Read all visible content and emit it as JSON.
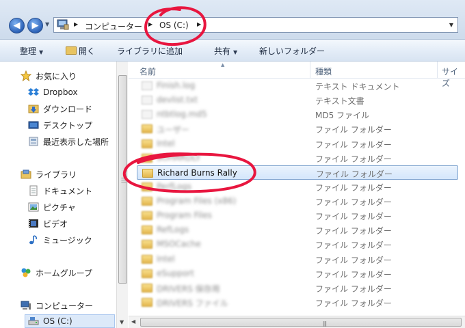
{
  "address": {
    "crumbs": [
      "コンピューター",
      "OS (C:)"
    ],
    "nav_back_glyph": "◀",
    "nav_forward_glyph": "▶"
  },
  "toolbar": {
    "organize": "整理",
    "open": "開く",
    "library": "ライブラリに追加",
    "share": "共有",
    "new_folder": "新しいフォルダー"
  },
  "sidebar": {
    "favorites": "お気に入り",
    "favorites_items": [
      "Dropbox",
      "ダウンロード",
      "デスクトップ",
      "最近表示した場所"
    ],
    "libraries": "ライブラリ",
    "libraries_items": [
      "ドキュメント",
      "ピクチャ",
      "ビデオ",
      "ミュージック"
    ],
    "homegroup": "ホームグループ",
    "computer": "コンピューター",
    "computer_items": [
      "OS (C:)"
    ]
  },
  "columns": {
    "name": "名前",
    "type": "種類",
    "size": "サイズ"
  },
  "files": [
    {
      "name": "Finish.log",
      "type": "テキスト ドキュメント",
      "icon": "file",
      "blurred": true
    },
    {
      "name": "devlist.txt",
      "type": "テキスト文書",
      "icon": "file",
      "blurred": true
    },
    {
      "name": "ntbtlog.md5",
      "type": "MD5 ファイル",
      "icon": "file",
      "blurred": true
    },
    {
      "name": "ユーザー",
      "type": "ファイル フォルダー",
      "icon": "folder",
      "blurred": true
    },
    {
      "name": "Intel",
      "type": "ファイル フォルダー",
      "icon": "folder",
      "blurred": true
    },
    {
      "name": "SOHARDLY",
      "type": "ファイル フォルダー",
      "icon": "folder",
      "blurred": true
    },
    {
      "name": "Richard Burns Rally",
      "type": "ファイル フォルダー",
      "icon": "folder",
      "blurred": false,
      "selected": true
    },
    {
      "name": "PerfLogs",
      "type": "ファイル フォルダー",
      "icon": "folder",
      "blurred": true
    },
    {
      "name": "Program Files (x86)",
      "type": "ファイル フォルダー",
      "icon": "folder",
      "blurred": true
    },
    {
      "name": "Program Files",
      "type": "ファイル フォルダー",
      "icon": "folder",
      "blurred": true
    },
    {
      "name": "RefLogs",
      "type": "ファイル フォルダー",
      "icon": "folder",
      "blurred": true
    },
    {
      "name": "MSOCache",
      "type": "ファイル フォルダー",
      "icon": "folder",
      "blurred": true
    },
    {
      "name": "Intel",
      "type": "ファイル フォルダー",
      "icon": "folder",
      "blurred": true
    },
    {
      "name": "eSupport",
      "type": "ファイル フォルダー",
      "icon": "folder",
      "blurred": true
    },
    {
      "name": "DRIVERS 保存用",
      "type": "ファイル フォルダー",
      "icon": "folder",
      "blurred": true
    },
    {
      "name": "DRIVERS ファイル",
      "type": "ファイル フォルダー",
      "icon": "folder",
      "blurred": true
    }
  ],
  "colors": {
    "annotation": "#e8163f",
    "selection_border": "#7da2ce",
    "folder": "#e8c461"
  }
}
